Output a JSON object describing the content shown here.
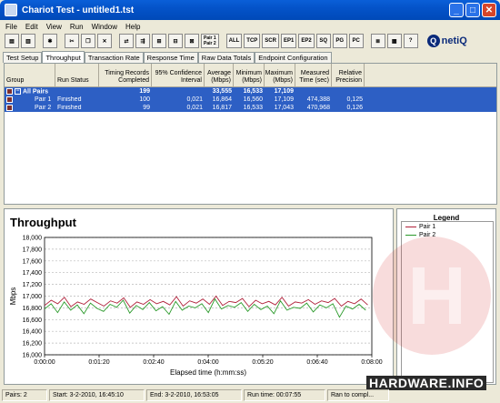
{
  "window": {
    "title": "Chariot Test - untitled1.tst",
    "min": "_",
    "max": "□",
    "close": "✕"
  },
  "menu": [
    "File",
    "Edit",
    "View",
    "Run",
    "Window",
    "Help"
  ],
  "toolbar": {
    "pair_button_top": "Pair 1",
    "pair_button_bottom": "Pair 2",
    "groups": [
      "ALL",
      "TCP",
      "SCR",
      "EP1",
      "EP2",
      "SQ",
      "PG",
      "PC"
    ],
    "netiq": "netiQ"
  },
  "tabs": [
    "Test Setup",
    "Throughput",
    "Transaction Rate",
    "Response Time",
    "Raw Data Totals",
    "Endpoint Configuration"
  ],
  "table": {
    "headers": [
      "Group",
      "Run Status",
      "Timing Records Completed",
      "95% Confidence Interval",
      "Average (Mbps)",
      "Minimum (Mbps)",
      "Maximum (Mbps)",
      "Measured Time (sec)",
      "Relative Precision"
    ],
    "rows": [
      {
        "group": "All Pairs",
        "status": "",
        "records": "199",
        "ci": "",
        "avg": "33,555",
        "min": "16,533",
        "max": "17,109",
        "time": "",
        "precision": ""
      },
      {
        "group": "Pair 1",
        "status": "Finished",
        "records": "100",
        "ci": "0,021",
        "avg": "16,864",
        "min": "16,560",
        "max": "17,109",
        "time": "474,388",
        "precision": "0,125"
      },
      {
        "group": "Pair 2",
        "status": "Finished",
        "records": "99",
        "ci": "0,021",
        "avg": "16,817",
        "min": "16,533",
        "max": "17,043",
        "time": "470,968",
        "precision": "0,126"
      }
    ]
  },
  "chart_data": {
    "type": "line",
    "title": "Throughput",
    "xlabel": "Elapsed time (h:mm:ss)",
    "ylabel": "Mbps",
    "xlim": [
      0,
      480
    ],
    "ylim": [
      16000,
      18000
    ],
    "x_ticks": [
      "0:00:00",
      "0:01:20",
      "0:02:40",
      "0:04:00",
      "0:05:20",
      "0:06:40",
      "0:08:00"
    ],
    "y_ticks": [
      "16,000",
      "16,200",
      "16,400",
      "16,600",
      "16,800",
      "17,000",
      "17,200",
      "17,400",
      "17,600",
      "17,800",
      "18,000"
    ],
    "grid": "horizontal dashed",
    "legend": "right panel",
    "series": [
      {
        "name": "Pair 1",
        "color": "#b0203a",
        "values": [
          16840,
          16930,
          16870,
          16980,
          16820,
          16900,
          16860,
          16950,
          16890,
          16830,
          16920,
          16880,
          16970,
          16810,
          16900,
          16860,
          16940,
          16870,
          16910,
          16850,
          16990,
          16830,
          16920,
          16880,
          16950,
          16860,
          17000,
          16840,
          16910,
          16890,
          16960,
          16820,
          16930,
          16870,
          16910,
          16850,
          16980,
          16830,
          16900,
          16880,
          16940,
          16860,
          16920,
          16890,
          16960,
          16830,
          16910,
          16870,
          16950,
          16850
        ]
      },
      {
        "name": "Pair 2",
        "color": "#2a9a2a",
        "values": [
          16780,
          16870,
          16720,
          16900,
          16760,
          16850,
          16700,
          16880,
          16790,
          16740,
          16860,
          16810,
          16930,
          16710,
          16840,
          16770,
          16890,
          16750,
          16820,
          16690,
          16910,
          16760,
          16830,
          16800,
          16870,
          16720,
          16950,
          16780,
          16840,
          16810,
          16890,
          16740,
          16860,
          16770,
          16830,
          16700,
          16920,
          16760,
          16810,
          16790,
          16880,
          16730,
          16850,
          16800,
          16870,
          16640,
          16830,
          16780,
          16860,
          16760
        ]
      }
    ]
  },
  "legend": {
    "title": "Legend"
  },
  "watermark": {
    "text": "HARDWARE.INFO",
    "letter": "H"
  },
  "status": [
    "Pairs: 2",
    "Start: 3-2-2010, 16:45:10",
    "End: 3-2-2010, 16:53:05",
    "Run time: 00:07:55",
    "Ran to compl..."
  ]
}
